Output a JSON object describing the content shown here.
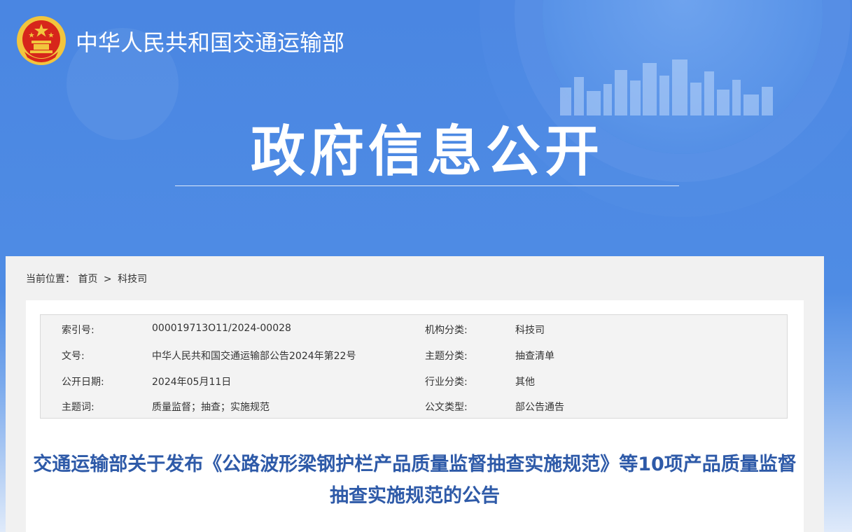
{
  "header": {
    "ministry_name": "中华人民共和国交通运输部",
    "page_heading": "政府信息公开",
    "logo_icon": "national-emblem-icon"
  },
  "breadcrumb": {
    "label": "当前位置：",
    "items": [
      "首页",
      "科技司"
    ],
    "separator": ">"
  },
  "metadata": {
    "rows": [
      {
        "k1": "索引号:",
        "v1": "000019713O11/2024-00028",
        "k2": "机构分类:",
        "v2": "科技司"
      },
      {
        "k1": "文号:",
        "v1": "中华人民共和国交通运输部公告2024年第22号",
        "k2": "主题分类:",
        "v2": "抽查清单"
      },
      {
        "k1": "公开日期:",
        "v1": "2024年05月11日",
        "k2": "行业分类:",
        "v2": "其他"
      },
      {
        "k1": "主题词:",
        "v1": "质量监督；抽查；实施规范",
        "k2": "公文类型:",
        "v2": "部公告通告"
      }
    ]
  },
  "article": {
    "title": "交通运输部关于发布《公路波形梁钢护栏产品质量监督抽查实施规范》等10项产品质量监督抽查实施规范的公告"
  },
  "colors": {
    "banner_blue": "#4a86e2",
    "title_blue": "#2e5aa8",
    "emblem_red": "#d7261b",
    "emblem_gold": "#f2c53d"
  }
}
